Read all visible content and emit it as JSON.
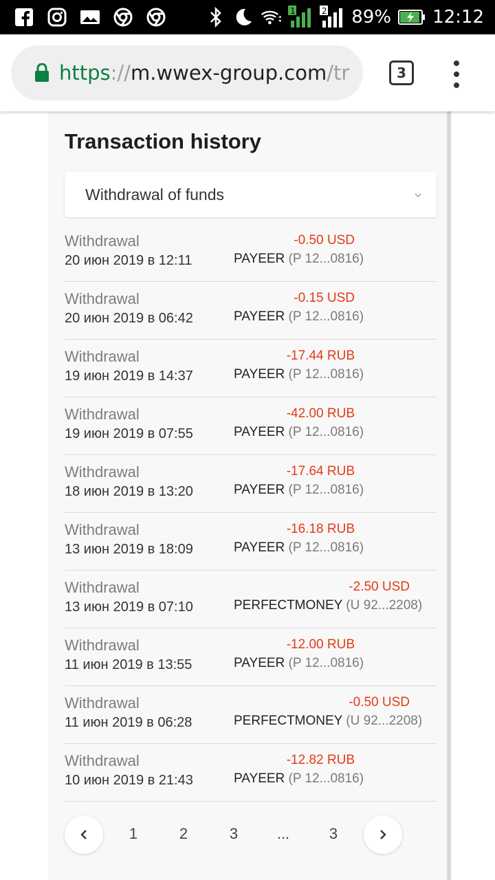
{
  "status_bar": {
    "battery": "89%",
    "time": "12:12",
    "sim1": "1",
    "sim2": "2",
    "icons": [
      "facebook-icon",
      "instagram-icon",
      "gallery-icon",
      "chrome-icon",
      "chrome-icon",
      "bluetooth-icon",
      "moon-icon",
      "wifi-icon",
      "signal-icon",
      "signal-icon",
      "battery-charging-icon"
    ]
  },
  "browser": {
    "url_scheme": "https",
    "url_sep": "://",
    "url_host": "m.wwex-group.com",
    "url_path": "/tr",
    "tab_count": "3"
  },
  "page": {
    "title": "Transaction history",
    "filter_value": "Withdrawal of funds"
  },
  "transactions": [
    {
      "type": "Withdrawal",
      "date": "20 июн 2019 в 12:11",
      "amount": "-0.50 USD",
      "method": "PAYEER",
      "account": "(P 12...0816)"
    },
    {
      "type": "Withdrawal",
      "date": "20 июн 2019 в 06:42",
      "amount": "-0.15 USD",
      "method": "PAYEER",
      "account": "(P 12...0816)"
    },
    {
      "type": "Withdrawal",
      "date": "19 июн 2019 в 14:37",
      "amount": "-17.44 RUB",
      "method": "PAYEER",
      "account": "(P 12...0816)"
    },
    {
      "type": "Withdrawal",
      "date": "19 июн 2019 в 07:55",
      "amount": "-42.00 RUB",
      "method": "PAYEER",
      "account": "(P 12...0816)"
    },
    {
      "type": "Withdrawal",
      "date": "18 июн 2019 в 13:20",
      "amount": "-17.64 RUB",
      "method": "PAYEER",
      "account": "(P 12...0816)"
    },
    {
      "type": "Withdrawal",
      "date": "13 июн 2019 в 18:09",
      "amount": "-16.18 RUB",
      "method": "PAYEER",
      "account": "(P 12...0816)"
    },
    {
      "type": "Withdrawal",
      "date": "13 июн 2019 в 07:10",
      "amount": "-2.50 USD",
      "method": "PERFECTMONEY",
      "account": "(U 92...2208)"
    },
    {
      "type": "Withdrawal",
      "date": "11 июн 2019 в 13:55",
      "amount": "-12.00 RUB",
      "method": "PAYEER",
      "account": "(P 12...0816)"
    },
    {
      "type": "Withdrawal",
      "date": "11 июн 2019 в 06:28",
      "amount": "-0.50 USD",
      "method": "PERFECTMONEY",
      "account": "(U 92...2208)"
    },
    {
      "type": "Withdrawal",
      "date": "10 июн 2019 в 21:43",
      "amount": "-12.82 RUB",
      "method": "PAYEER",
      "account": "(P 12...0816)"
    }
  ],
  "pagination": {
    "prev_icon": "chevron-left-icon",
    "next_icon": "chevron-right-icon",
    "pages": [
      "1",
      "2",
      "3",
      "...",
      "3"
    ]
  },
  "colors": {
    "amount_negative": "#e53a17",
    "secure_green": "#0b8043"
  }
}
